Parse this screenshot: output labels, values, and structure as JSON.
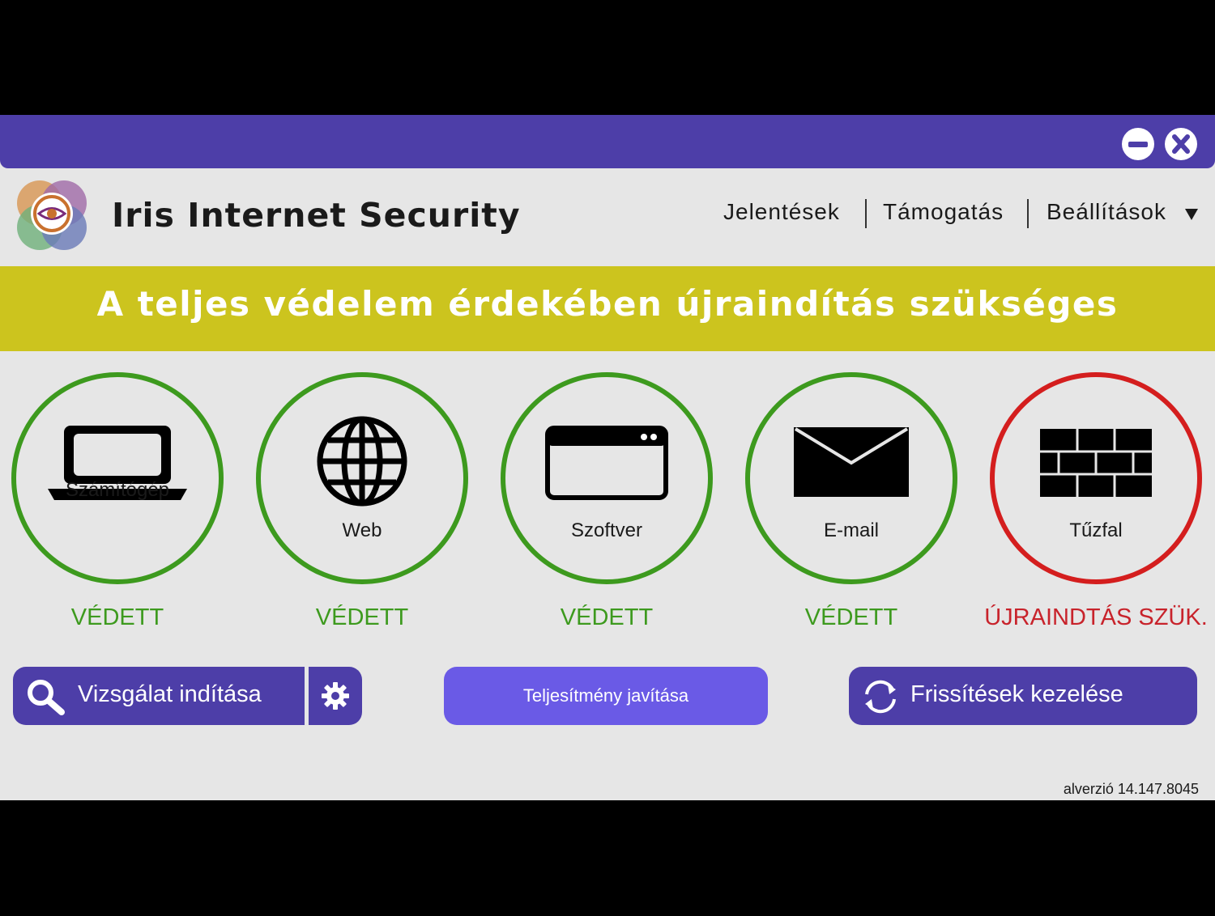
{
  "app": {
    "title": "Iris Internet Security"
  },
  "nav": {
    "reports": "Jelentések",
    "support": "Támogatás",
    "settings": "Beállítások"
  },
  "banner": {
    "text": "A teljes védelem érdekében újraindítás szükséges"
  },
  "tiles": [
    {
      "label": "Számítógép",
      "status": "VÉDETT",
      "icon": "laptop-icon",
      "state_color": "#3d9a1e"
    },
    {
      "label": "Web",
      "status": "VÉDETT",
      "icon": "globe-icon",
      "state_color": "#3d9a1e"
    },
    {
      "label": "Szoftver",
      "status": "VÉDETT",
      "icon": "app-window-icon",
      "state_color": "#3d9a1e"
    },
    {
      "label": "E-mail",
      "status": "VÉDETT",
      "icon": "envelope-icon",
      "state_color": "#3d9a1e"
    },
    {
      "label": "Tűzfal",
      "status": "ÚJRAINDTÁS SZÜK.",
      "icon": "brick-wall-icon",
      "state_color": "#d41e1e"
    }
  ],
  "actions": {
    "scan": "Vizsgálat indítása",
    "performance": "Teljesítmény javítása",
    "updates": "Frissítések kezelése"
  },
  "footer": {
    "version": "alverzió 14.147.8045"
  },
  "colors": {
    "primary": "#4d3ea8",
    "accent": "#6a5ae6",
    "banner": "#ccc41e",
    "ok": "#3d9a1e",
    "alert": "#d41e1e"
  }
}
